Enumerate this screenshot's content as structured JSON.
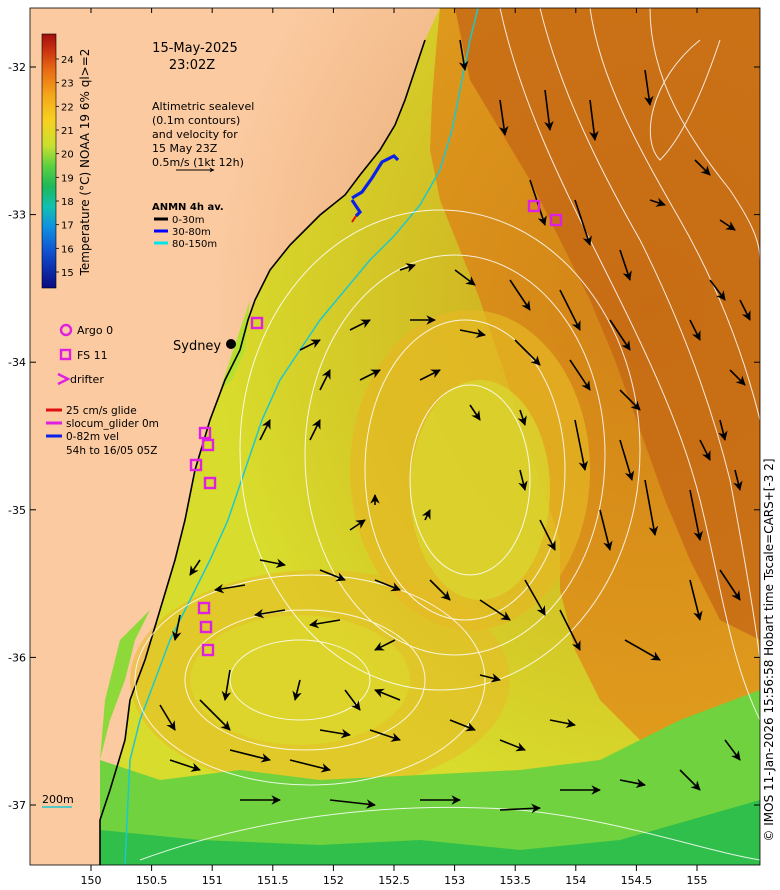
{
  "header": {
    "date": "15-May-2025",
    "time": "23:02Z"
  },
  "colorbar": {
    "label": "Temperature (°C) NOAA 19 6% ql>=2",
    "ticks": [
      "24",
      "23",
      "22",
      "21",
      "20",
      "19",
      "18",
      "17",
      "16",
      "15"
    ]
  },
  "altimetry_note": {
    "lines": [
      "Altimetric sealevel",
      "(0.1m contours)",
      "and velocity for",
      "15 May 23Z",
      "0.5m/s (1kt 12h)"
    ]
  },
  "anmn_legend": {
    "title": "ANMN 4h av.",
    "items": [
      {
        "label": "0-30m",
        "color": "#000000"
      },
      {
        "label": "30-80m",
        "color": "#0000ff"
      },
      {
        "label": "80-150m",
        "color": "#00e5ee"
      }
    ]
  },
  "platform_legend": {
    "argo": "Argo 0",
    "fs": "FS 11",
    "drifter": "drifter"
  },
  "glider_legend": {
    "lines": [
      "25 cm/s glide",
      "slocum_glider 0m",
      "0-82m vel",
      "54h to 16/05 05Z"
    ]
  },
  "city": {
    "name": "Sydney"
  },
  "axes": {
    "lon_ticks": [
      "150",
      "150.5",
      "151",
      "151.5",
      "152",
      "152.5",
      "153",
      "153.5",
      "154",
      "154.5",
      "155"
    ],
    "lat_ticks": [
      "-32",
      "-33",
      "-34",
      "-35",
      "-36",
      "-37"
    ]
  },
  "scale_label": "200m",
  "credit": "© IMOS 11-Jan-2026 15:56:58 Hobart time Tscale=CARS+[-3 2]",
  "colors": {
    "land": "#fbcaa0",
    "warm_sst": "#d47a18",
    "mid_sst": "#e8b020",
    "cool_sst": "#d6e02a",
    "coastal_green": "#8ed93a",
    "deep_green": "#2fbf4a",
    "contour": "#ffffff",
    "isobath": "#1cc8d0",
    "fs_marker": "#e020e0"
  }
}
